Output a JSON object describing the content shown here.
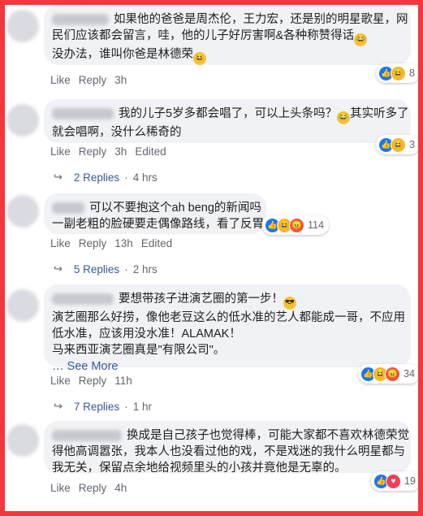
{
  "comments": [
    {
      "lines": [
        "如果他的爸爸是周杰伦，王力宏，还是别的明星歌星，网",
        "民们应该都会留言，哇，他的儿子好厉害啊&各种称赞得话",
        "没办法，谁叫你爸是林德荣"
      ],
      "like": "Like",
      "reply": "Reply",
      "time": "3h",
      "edited": "",
      "reaction_count": "8"
    },
    {
      "lines": [
        "我的儿子5岁多都会唱了，可以上头条吗？",
        "就会唱啊，没什么稀奇的"
      ],
      "inline_tail": "其实听多了",
      "like": "Like",
      "reply": "Reply",
      "time": "3h",
      "edited": "Edited",
      "reaction_count": "3",
      "replies_label": "2 Replies",
      "replies_time": "4 hrs"
    },
    {
      "lines": [
        "可以不要抱这个ah beng的新闻吗",
        "一副老粗的脸硬要走偶像路线，看了反胃"
      ],
      "like": "Like",
      "reply": "Reply",
      "time": "13h",
      "edited": "Edited",
      "reaction_count": "114",
      "replies_label": "5 Replies",
      "replies_time": "2 hrs"
    },
    {
      "lines": [
        "要想带孩子进演艺圈的第一步！",
        "演艺圈那么好捞，像他老豆这么的低水准的艺人都能成一哥，不应用",
        "低水准，应该用没水准！ALAMAK！",
        "马来西亚演艺圈真是\"有限公司\"。"
      ],
      "see_more": "… See More",
      "like": "Like",
      "reply": "Reply",
      "time": "11h",
      "edited": "",
      "reaction_count": "34",
      "replies_label": "7 Replies",
      "replies_time": "1 hr"
    },
    {
      "lines": [
        "换成是自己孩子也觉得棒，可能大家都不喜欢林德荣觉",
        "得他高调嚣张，我本人也没看过他的戏，不是戏迷的我什么明星都与",
        "我无关，保留点余地给视频里头的小孩并竟他是无辜的。"
      ],
      "like": "Like",
      "reply": "Reply",
      "time": "4h",
      "edited": "",
      "reaction_count": "19"
    }
  ],
  "icons": {
    "like": "thumbs-up-icon",
    "haha": "laughing-face-icon",
    "angry": "angry-face-icon",
    "reply_arrow": "reply-arrow-icon"
  },
  "colors": {
    "frame": "#f4363d",
    "bubble": "#f0f2f5",
    "link": "#385898",
    "like_blue": "#1877f2"
  }
}
